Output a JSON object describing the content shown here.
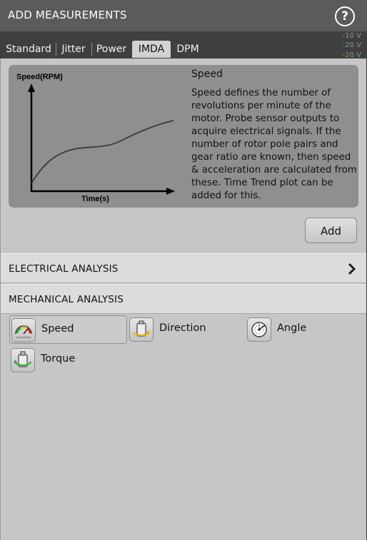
{
  "window": {
    "title": "ADD MEASUREMENTS",
    "help_icon": "question-mark-icon",
    "help_glyph": "?"
  },
  "tabs": [
    {
      "label": "Standard",
      "active": false
    },
    {
      "label": "Jitter",
      "active": false
    },
    {
      "label": "Power",
      "active": false
    },
    {
      "label": "IMDA",
      "active": true
    },
    {
      "label": "DPM",
      "active": false
    }
  ],
  "background_readouts": [
    "-10 V",
    "-20 V",
    "-20 V"
  ],
  "info": {
    "plot_ylabel": "Speed(RPM)",
    "plot_xlabel": "Time(s)",
    "title": "Speed",
    "description": "Speed defines the number of revolutions per minute of the motor. Probe sensor outputs to acquire electrical signals. If the number of rotor pole pairs and gear ratio are known, then speed & acceleration are calculated from these. Time Trend plot can be added for this."
  },
  "add_button_label": "Add",
  "sections": [
    {
      "label": "ELECTRICAL ANALYSIS",
      "icon": "chevron-right-icon"
    },
    {
      "label": "MECHANICAL ANALYSIS"
    }
  ],
  "measurements": [
    {
      "label": "Speed",
      "icon": "speedometer-icon",
      "selected": true
    },
    {
      "label": "Direction",
      "icon": "motor-direction-icon",
      "selected": false
    },
    {
      "label": "Angle",
      "icon": "angle-dial-icon",
      "selected": false
    },
    {
      "label": "Torque",
      "icon": "torque-motor-icon",
      "selected": false
    }
  ],
  "colors": {
    "titlebar": "#5b5b5b",
    "panel": "#c6c6c6",
    "info_box": "#8f8f8f",
    "active_tab": "#d2d2d2"
  }
}
